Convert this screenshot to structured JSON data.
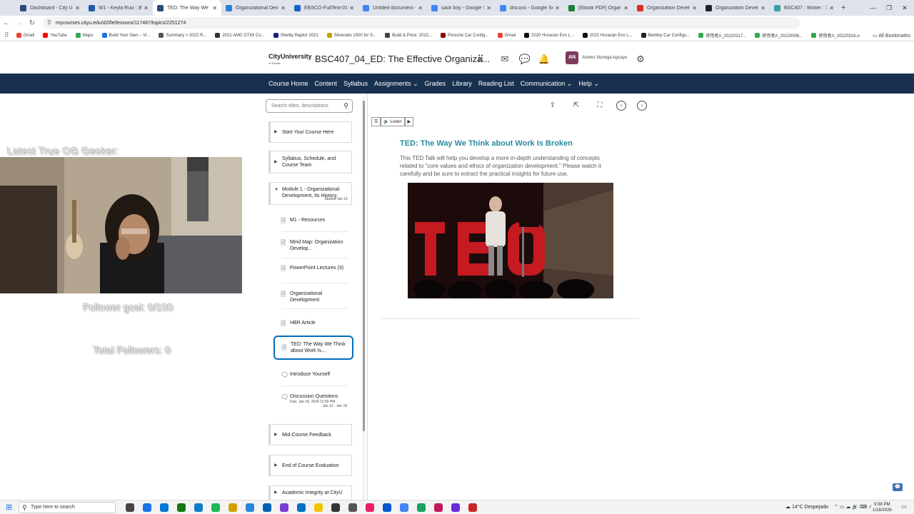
{
  "browser": {
    "tabs": [
      {
        "label": "Dashboard - City Univ",
        "color": "#2a4a7a",
        "active": false
      },
      {
        "label": "W1 - Keyla Ruiz : BSC",
        "color": "#1f5aa6",
        "active": false
      },
      {
        "label": "TED: The Way We",
        "color": "#2a4a7a",
        "active": true
      },
      {
        "label": "Organizational Develo",
        "color": "#2b7fd8",
        "active": false
      },
      {
        "label": "EBSCO-FullText-01_18",
        "color": "#1565c0",
        "active": false
      },
      {
        "label": "Untitled document - G",
        "color": "#4285f4",
        "active": false
      },
      {
        "label": "sack boy - Google Sea",
        "color": "#4285f4",
        "active": false
      },
      {
        "label": "discuss - Google Searc",
        "color": "#4285f4",
        "active": false
      },
      {
        "label": "[Ebook PDF] Organizat",
        "color": "#188038",
        "active": false
      },
      {
        "label": "Organization Develop",
        "color": "#d93025",
        "active": false
      },
      {
        "label": "Organization Develop",
        "color": "#222222",
        "active": false
      },
      {
        "label": "BSC407 : Winter : 126",
        "color": "#3aa0a8",
        "active": false
      }
    ],
    "new_tab": "+",
    "url": "mycourses.cityu.edu/d2l/le/lessons/117487/topics/2251274",
    "bookmarks": [
      {
        "label": "Gmail",
        "color": "#ea4335"
      },
      {
        "label": "YouTube",
        "color": "#ff0000"
      },
      {
        "label": "Maps",
        "color": "#34a853"
      },
      {
        "label": "Build Your Own – Vi...",
        "color": "#1a73e8"
      },
      {
        "label": "Summary > 2022 R...",
        "color": "#555555"
      },
      {
        "label": "2021 AMG GT63 Co...",
        "color": "#333333"
      },
      {
        "label": "Shelby Raptor 2021",
        "color": "#1a237e"
      },
      {
        "label": "Silverado 1500 for S...",
        "color": "#c9a100"
      },
      {
        "label": "Build & Price: 2022...",
        "color": "#444444"
      },
      {
        "label": "Porsche Car Config...",
        "color": "#8b0000"
      },
      {
        "label": "Gmail",
        "color": "#ea4335"
      },
      {
        "label": "2020 Huracán Evo L...",
        "color": "#111111"
      },
      {
        "label": "2021 Huracán Evo L...",
        "color": "#111111"
      },
      {
        "label": "Bentley Car Configu...",
        "color": "#222222"
      },
      {
        "label": "使用者A_20220317...",
        "color": "#34a853"
      },
      {
        "label": "使用者A_20220006...",
        "color": "#34a853"
      },
      {
        "label": "使用者A_20220316...",
        "color": "#34a853"
      }
    ],
    "all_bookmarks": "All Bookmarks"
  },
  "header": {
    "logo": "CityUniversity",
    "logo_sub": "of Seattle",
    "course_title": "BSC407_04_ED: The Effective Organiza...",
    "avatar_initials": "AN",
    "avatar_color": "#7e3b5e",
    "user_name": "Andres Noriega Aguayo"
  },
  "nav": {
    "items": [
      "Course Home",
      "Content",
      "Syllabus",
      "Assignments ⌄",
      "Grades",
      "Library",
      "Reading List",
      "Communication ⌄",
      "Help ⌄"
    ],
    "bg": "#18314f"
  },
  "overlay": {
    "title": "Latest True OG Geeker:",
    "follower_goal": "Follower goal: 0/100",
    "total_followers": "Total Followers: 0"
  },
  "sidebar": {
    "search_placeholder": "Search titles, descriptions",
    "modules": [
      {
        "label": "Start Your Course Here"
      },
      {
        "label": "Syllabus, Schedule, and Course Team"
      },
      {
        "label": "Module 1 - Organizational Development, Its History,",
        "started": "Started Jan 12"
      },
      {
        "label": "Mid-Course Feedback"
      },
      {
        "label": "End of Course Evaluation"
      },
      {
        "label": "Academic Integrity at CityU"
      }
    ],
    "topics": [
      {
        "label": "M1 - Resources"
      },
      {
        "label": "Mind Map: Organization Develop..."
      },
      {
        "label": "PowerPoint Lectures (3)"
      },
      {
        "label": "Organizational Development"
      },
      {
        "label": "HBR Article"
      },
      {
        "label": "TED: The Way We Think about Work Is..."
      },
      {
        "label": "Introduce Yourself"
      },
      {
        "label": "Discussion Questions",
        "due": "Due: Jan 18, 2026 11:59 PM",
        "range": "Jan 12 - Jan 18"
      }
    ]
  },
  "content": {
    "listen": "Listen",
    "title": "TED: The Way We Think about Work Is Broken",
    "description": "This TED Talk will help you develop a more in-depth understanding of concepts related to \"core values and ethics of organization development.\" Please watch it carefully and be sure to extract the practical insights for future use.",
    "title_color": "#2a8c9c"
  },
  "taskbar": {
    "search_placeholder": "Type here to search",
    "weather": "14°C  Despejado",
    "time": "9:38 PM",
    "date": "1/18/2026"
  }
}
